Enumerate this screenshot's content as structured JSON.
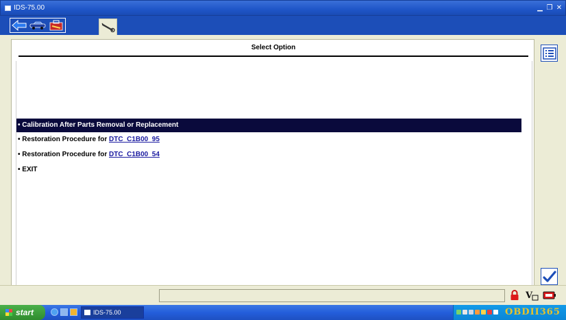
{
  "window": {
    "title": "IDS-75.00"
  },
  "panel": {
    "title": "Select Option"
  },
  "options": [
    {
      "text": "Calibration After Parts Removal or Replacement",
      "link": ""
    },
    {
      "text": "Restoration Procedure for ",
      "link": "DTC_C1B00_95"
    },
    {
      "text": "Restoration Procedure for ",
      "link": "DTC_C1B00_54"
    },
    {
      "text": "EXIT",
      "link": ""
    }
  ],
  "bullet": "•",
  "taskbar": {
    "start_label": "start",
    "task_label": "IDS-75.00",
    "tray_logo": "OBDII365"
  },
  "colors": {
    "titlebar": "#1f56c8",
    "toolbar": "#1c4eb8",
    "background": "#ececd6",
    "selected_row": "#0a0a3c",
    "link": "#1a1aa0"
  },
  "icons": {
    "toolbar": [
      "back-arrow-icon",
      "vehicle-icon",
      "toolbox-icon",
      "wrench-icon"
    ],
    "side": [
      "list-icon",
      "checkmark-icon"
    ],
    "status": [
      "lock-icon",
      "vehicle-battery-voltage-icon",
      "battery-icon"
    ]
  }
}
